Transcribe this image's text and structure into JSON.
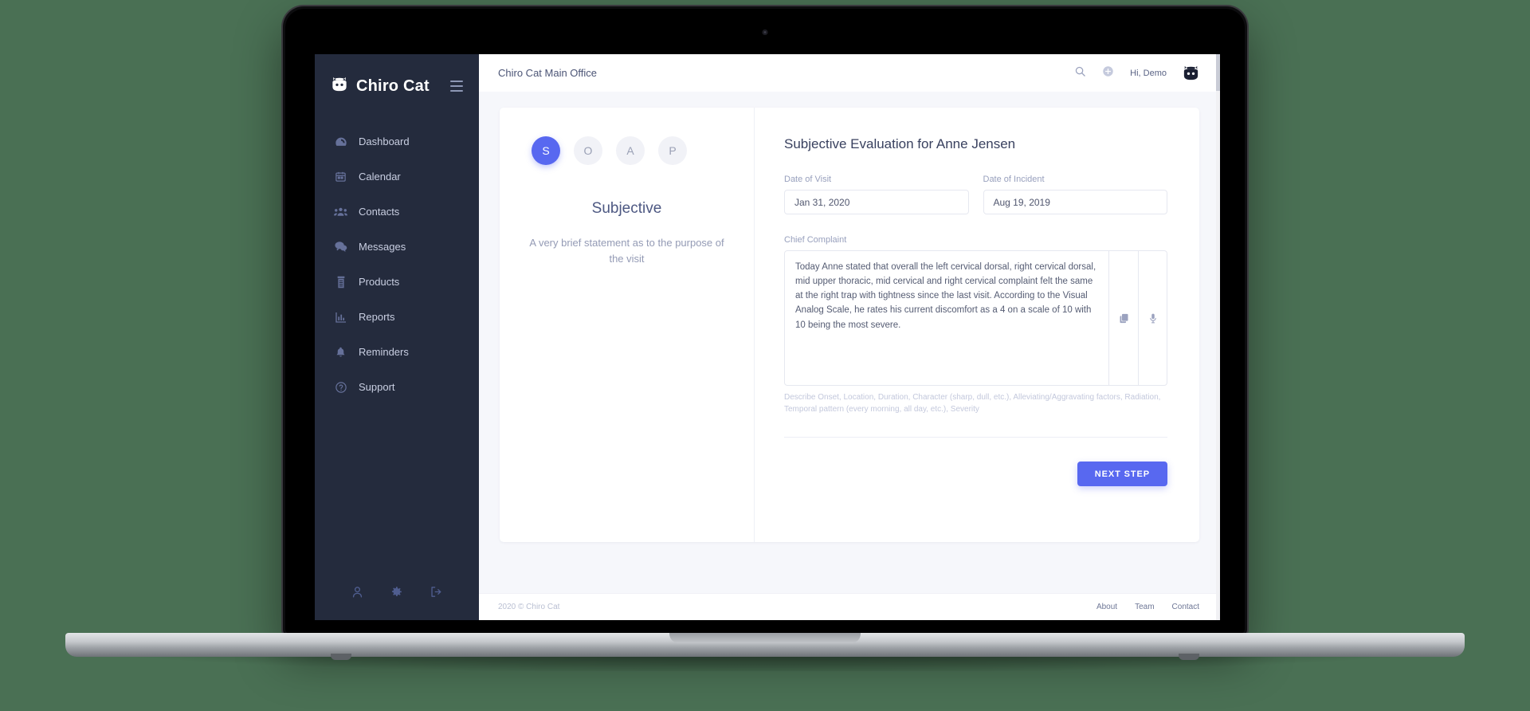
{
  "device": {
    "label": "MacBook Pro"
  },
  "sidebar": {
    "brand": {
      "name": "Chiro Cat",
      "logo_icon": "cat-logo-icon"
    },
    "menu_icon": "hamburger-menu-icon",
    "items": [
      {
        "label": "Dashboard",
        "icon": "dashboard-icon"
      },
      {
        "label": "Calendar",
        "icon": "calendar-icon"
      },
      {
        "label": "Contacts",
        "icon": "contacts-icon"
      },
      {
        "label": "Messages",
        "icon": "messages-icon"
      },
      {
        "label": "Products",
        "icon": "products-icon"
      },
      {
        "label": "Reports",
        "icon": "reports-icon"
      },
      {
        "label": "Reminders",
        "icon": "bell-icon"
      },
      {
        "label": "Support",
        "icon": "help-circle-icon"
      }
    ],
    "bottom_icons": [
      "user-icon",
      "gear-icon",
      "logout-icon"
    ],
    "bg_color": "#242b3d"
  },
  "header": {
    "office_title": "Chiro Cat Main Office",
    "search_icon": "search-icon",
    "add_icon": "plus-circle-icon",
    "greeting": "Hi,  Demo",
    "avatar_icon": "cat-avatar-icon"
  },
  "steps": [
    {
      "letter": "S",
      "name": "subjective",
      "active": true
    },
    {
      "letter": "O",
      "name": "objective",
      "active": false
    },
    {
      "letter": "A",
      "name": "assessment",
      "active": false
    },
    {
      "letter": "P",
      "name": "plan",
      "active": false
    }
  ],
  "left_panel": {
    "title": "Subjective",
    "description": "A very brief statement as to the purpose of the visit"
  },
  "form": {
    "title": "Subjective Evaluation for Anne Jensen",
    "date_of_visit": {
      "label": "Date of Visit",
      "value": "Jan 31, 2020"
    },
    "date_of_incident": {
      "label": "Date of Incident",
      "value": "Aug 19, 2019"
    },
    "chief_complaint": {
      "label": "Chief Complaint",
      "value": "Today Anne stated that overall the left cervical dorsal, right cervical dorsal, mid upper thoracic, mid cervical and right cervical complaint felt the same at the right trap with tightness since the last visit. According to the Visual Analog Scale, he rates his current discomfort as a 4 on a scale of 10 with 10 being the most severe.",
      "helper": "Describe Onset, Location, Duration, Character (sharp, dull, etc.), Alleviating/Aggravating factors, Radiation, Temporal pattern (every morning, all day, etc.), Severity",
      "copy_icon": "copy-icon",
      "mic_icon": "microphone-icon"
    },
    "next_button": "NEXT STEP",
    "accent_color": "#5868f0"
  },
  "footer": {
    "copyright": "2020 © Chiro Cat",
    "links": [
      "About",
      "Team",
      "Contact"
    ]
  }
}
